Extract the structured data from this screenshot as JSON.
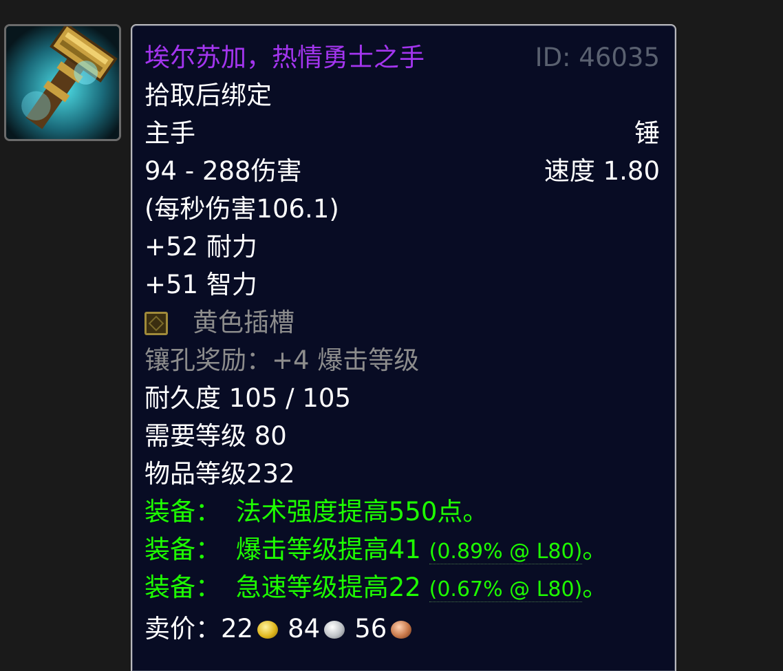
{
  "item": {
    "name": "埃尔苏加，热情勇士之手",
    "id_label": "ID: 46035",
    "binding": "拾取后绑定",
    "slot": "主手",
    "type": "锤",
    "damage": "94 - 288伤害",
    "speed": "速度 1.80",
    "dps": " (每秒伤害106.1)",
    "stats": [
      "+52 耐力",
      "+51 智力"
    ],
    "socket_label": "黄色插槽",
    "socket_bonus": "镶孔奖励：+4 爆击等级",
    "durability": "耐久度 105 / 105",
    "required_level": "需要等级 80",
    "item_level": "物品等级232",
    "equip_effects": [
      {
        "prefix": "装备：",
        "text": "法术强度提高550点。",
        "note": ""
      },
      {
        "prefix": "装备：",
        "text": "爆击等级提高41",
        "note": "(0.89% @ L80)",
        "suffix": "。"
      },
      {
        "prefix": "装备：",
        "text": "急速等级提高22",
        "note": "(0.67% @ L80)",
        "suffix": "。"
      }
    ],
    "sell_price": {
      "label": "卖价：",
      "gold": "22",
      "silver": "84",
      "copper": "56"
    }
  },
  "icons": {
    "item_icon": "mace-icon",
    "socket_icon": "yellow-socket-icon",
    "gold": "gold-coin-icon",
    "silver": "silver-coin-icon",
    "copper": "copper-coin-icon"
  },
  "colors": {
    "epic_purple": "#a335ee",
    "equip_green": "#1eff00",
    "tooltip_bg": "#080c24"
  }
}
